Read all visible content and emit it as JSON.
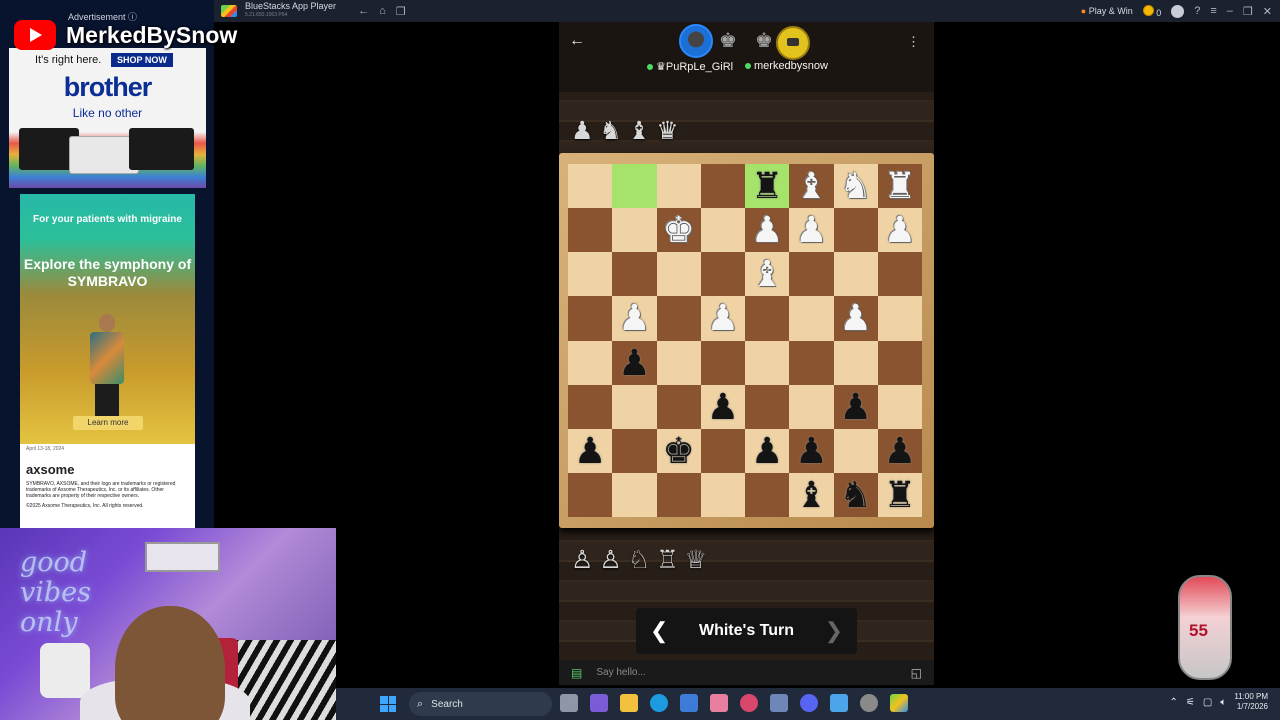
{
  "window": {
    "title": "BlueStacks App Player",
    "subtitle": "5.21.650.1063 P64",
    "play_win_label": "Play & Win",
    "coin_count": "0"
  },
  "stream": {
    "channel_name": "MerkedBySnow",
    "ad_label": "Advertisement ⓘ",
    "neon_text": "good vibes only"
  },
  "ads": {
    "brother": {
      "tagline": "It's right here.",
      "shop_button": "SHOP NOW",
      "brand": "brother",
      "slogan": "Like no other"
    },
    "symbravo": {
      "headline": "For your patients with migraine",
      "main": "Explore the symphony of SYMBRAVO",
      "cta": "Learn more"
    },
    "axsome": {
      "date": "April 13-18, 2024",
      "brand": "axsome",
      "legal": "SYMBRAVO, AXSOME, and their logo are trademarks or registered trademarks of Axsome Therapeutics, Inc. or its affiliates. Other trademarks are property of their respective owners.",
      "copyright": "©2025 Axsome Therapeutics, Inc. All rights reserved."
    }
  },
  "game": {
    "player1_name": "♛PuRpLe_GiRl",
    "player2_name": "merkedbysnow",
    "captured_top": "♟♞♝♛",
    "captured_bottom": "♙♙♘♖♕",
    "turn_label": "White's Turn",
    "chat_placeholder": "Say hello...",
    "board": [
      [
        "",
        "",
        "",
        "",
        "r",
        "B",
        "N",
        "R"
      ],
      [
        "",
        "",
        "K",
        "",
        "P",
        "P",
        "",
        "P"
      ],
      [
        "",
        "",
        "",
        "",
        "B",
        "",
        "",
        ""
      ],
      [
        "",
        "P",
        "",
        "P",
        "",
        "",
        "P",
        ""
      ],
      [
        "",
        "p",
        "",
        "",
        "",
        "",
        "",
        ""
      ],
      [
        "",
        "",
        "",
        "p",
        "",
        "",
        "p",
        ""
      ],
      [
        "p",
        "",
        "k",
        "",
        "p",
        "p",
        "",
        "p"
      ],
      [
        "",
        "",
        "",
        "",
        "",
        "b",
        "n",
        "r"
      ]
    ],
    "highlights": [
      [
        0,
        1
      ],
      [
        0,
        4
      ]
    ]
  },
  "taskbar": {
    "search_placeholder": "Search",
    "time": "11:00 PM",
    "date": "1/7/2026"
  },
  "badge_text": "55"
}
